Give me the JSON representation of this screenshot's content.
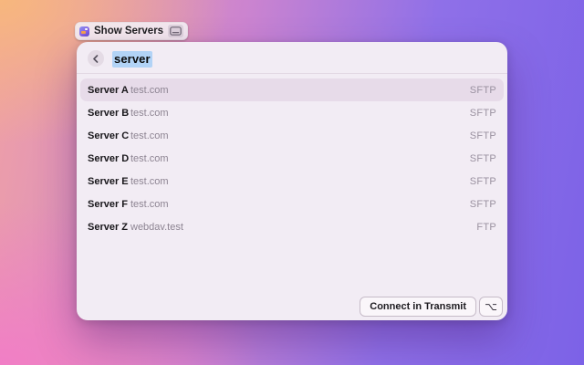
{
  "toolbar_pill": {
    "label": "Show Servers",
    "app_icon": "transmit-app-icon",
    "key_badge_icon": "keyboard-icon"
  },
  "panel": {
    "search": {
      "value": "server",
      "text_selected": true,
      "back_icon": "chevron-left-icon"
    },
    "servers": {
      "items": [
        {
          "name": "Server A",
          "host": "test.com",
          "protocol": "SFTP",
          "selected": true
        },
        {
          "name": "Server B",
          "host": "test.com",
          "protocol": "SFTP",
          "selected": false
        },
        {
          "name": "Server C",
          "host": "test.com",
          "protocol": "SFTP",
          "selected": false
        },
        {
          "name": "Server D",
          "host": "test.com",
          "protocol": "SFTP",
          "selected": false
        },
        {
          "name": "Server E",
          "host": "test.com",
          "protocol": "SFTP",
          "selected": false
        },
        {
          "name": "Server F",
          "host": "test.com",
          "protocol": "SFTP",
          "selected": false
        },
        {
          "name": "Server Z",
          "host": "webdav.test",
          "protocol": "FTP",
          "selected": false
        }
      ]
    },
    "action_bar": {
      "connect_label": "Connect in Transmit",
      "key_hint": "⌥"
    }
  },
  "colors": {
    "gradient_top_left": "#f7b77d",
    "gradient_bottom_left": "#f17ec6",
    "gradient_right": "#7c62e7",
    "panel_bg": "#f2ecf4",
    "row_highlight": "#e7dbe9",
    "selection_blue": "#b2d3f6"
  }
}
